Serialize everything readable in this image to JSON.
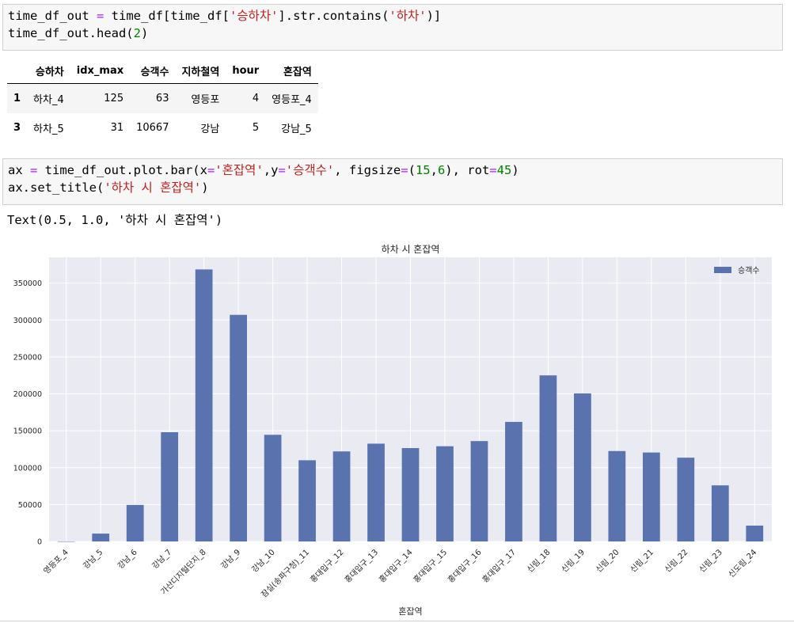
{
  "cell1": {
    "line1": {
      "a": "time_df_out ",
      "op": "=",
      "b": " time_df[time_df[",
      "s1": "'승하차'",
      "c": "].str.contains(",
      "s2": "'하차'",
      "d": ")]"
    },
    "line2": {
      "a": "time_df_out.head(",
      "n": "2",
      "b": ")"
    }
  },
  "table": {
    "columns": [
      "",
      "승하차",
      "idx_max",
      "승객수",
      "지하철역",
      "hour",
      "혼잡역"
    ],
    "rows": [
      [
        "1",
        "하차_4",
        "125",
        "63",
        "영등포",
        "4",
        "영등포_4"
      ],
      [
        "3",
        "하차_5",
        "31",
        "10667",
        "강남",
        "5",
        "강남_5"
      ]
    ]
  },
  "cell2": {
    "line1": {
      "a": "ax ",
      "op1": "=",
      "b": " time_df_out.plot.bar(x",
      "op2": "=",
      "s1": "'혼잡역'",
      "c": ",y",
      "op3": "=",
      "s2": "'승객수'",
      "d": ", figsize",
      "op4": "=",
      "e": "(",
      "n1": "15",
      "f": ",",
      "n2": "6",
      "g": "), rot",
      "op5": "=",
      "n3": "45",
      "h": ")"
    },
    "line2": {
      "a": "ax.set_title(",
      "s": "'하차 시 혼잡역'",
      "b": ")"
    }
  },
  "output_text": "Text(0.5, 1.0, '하차 시 혼잡역')",
  "chart_data": {
    "type": "bar",
    "title": "하차 시 혼잡역",
    "xlabel": "혼잡역",
    "ylabel": "",
    "legend": [
      "승객수"
    ],
    "legend_position": "top-right",
    "grid": true,
    "ylim": [
      0,
      385000
    ],
    "yticks": [
      0,
      50000,
      100000,
      150000,
      200000,
      250000,
      300000,
      350000
    ],
    "categories": [
      "영등포_4",
      "강남_5",
      "강남_6",
      "강남_7",
      "가산디지털단지_8",
      "강남_9",
      "강남_10",
      "잠실(송파구청)_11",
      "홍대입구_12",
      "홍대입구_13",
      "홍대입구_14",
      "홍대입구_15",
      "홍대입구_16",
      "홍대입구_17",
      "신림_18",
      "신림_19",
      "신림_20",
      "신림_21",
      "신림_22",
      "신림_23",
      "신도림_24"
    ],
    "series": [
      {
        "name": "승객수",
        "values": [
          63,
          10667,
          49500,
          148000,
          368500,
          307000,
          144500,
          110000,
          122000,
          132500,
          126500,
          129000,
          136000,
          162000,
          225000,
          200500,
          122500,
          120500,
          113500,
          76000,
          21500
        ]
      }
    ],
    "bar_color": "#5a72ad",
    "plot_bg": "#eaeaf2"
  }
}
